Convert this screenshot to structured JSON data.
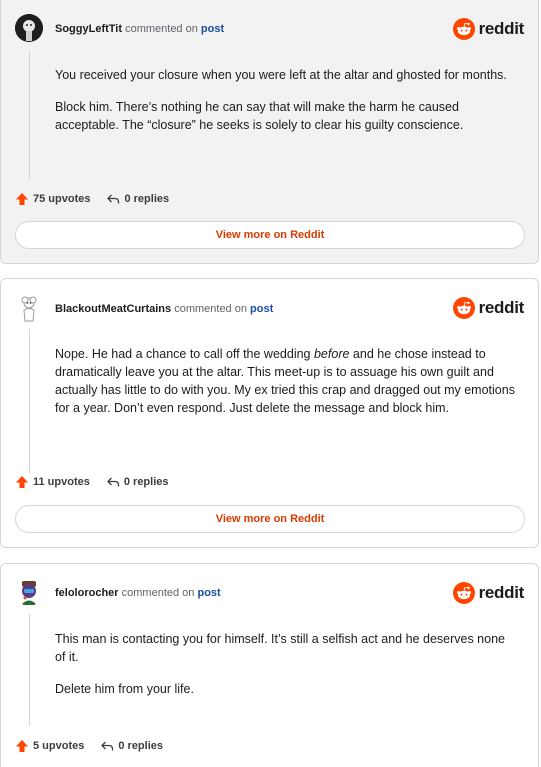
{
  "comments": [
    {
      "username": "SoggyLeftTit",
      "action": "commented on",
      "post_label": "post",
      "paragraphs": [
        [
          "You received your closure when you were left at the altar and ghosted for months."
        ],
        [
          "Block him. There’s nothing he can say that will make the harm he caused acceptable. The “closure” he seeks is solely to clear his guilty conscience."
        ]
      ],
      "upvotes": "75 upvotes",
      "replies": "0 replies",
      "view_more": "View more on Reddit"
    },
    {
      "username": "BlackoutMeatCurtains",
      "action": "commented on",
      "post_label": "post",
      "paragraph_parts": {
        "before_em": "Nope. He had a chance to call off the wedding ",
        "em": "before",
        "after_em": " and he chose instead to dramatically leave you at the altar. This meet-up is to assuage his own guilt and actually has little to do with you. My ex tried this crap and dragged out my emotions for a year. Don’t even respond. Just delete the message and block him."
      },
      "upvotes": "11 upvotes",
      "replies": "0 replies",
      "view_more": "View more on Reddit"
    },
    {
      "username": "felolorocher",
      "action": "commented on",
      "post_label": "post",
      "paragraphs": [
        [
          "This man is contacting you for himself. It’s still a selfish act and he deserves none of it."
        ],
        [
          "Delete him from your life."
        ]
      ],
      "upvotes": "5 upvotes",
      "replies": "0 replies"
    }
  ],
  "brand": {
    "wordmark": "reddit",
    "accent": "#ff4500",
    "link_color": "#1a4fa3",
    "button_text_color": "#d93a00"
  },
  "icons": {
    "logo": "reddit-snoo-icon",
    "upvote": "upvote-arrow-icon",
    "reply": "reply-arrow-icon"
  }
}
